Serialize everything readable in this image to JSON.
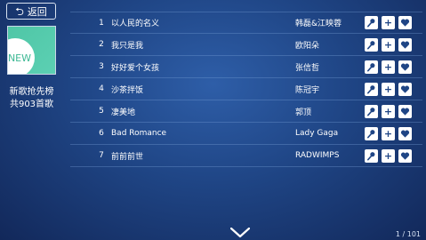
{
  "header": {
    "back_label": "返回"
  },
  "album": {
    "cover_badge": "NEW",
    "title": "新歌抢先榜",
    "count": "共903首歌"
  },
  "songs": [
    {
      "num": "1",
      "title": "以人民的名义",
      "artist": "韩磊&江映蓉"
    },
    {
      "num": "2",
      "title": "我只是我",
      "artist": "欧阳朵"
    },
    {
      "num": "3",
      "title": "好好爱个女孩",
      "artist": "张信哲"
    },
    {
      "num": "4",
      "title": "沙茶拌饭",
      "artist": "陈冠宇"
    },
    {
      "num": "5",
      "title": "凄美地",
      "artist": "郭顶"
    },
    {
      "num": "6",
      "title": "Bad Romance",
      "artist": "Lady Gaga"
    },
    {
      "num": "7",
      "title": "前前前世",
      "artist": "RADWIMPS"
    }
  ],
  "actions": {
    "icons": [
      "microphone-icon",
      "plus-icon",
      "heart-icon"
    ]
  },
  "pagination": {
    "text": "1 / 101"
  },
  "colors": {
    "background": "#1f4585",
    "cover": "#5cd0b3",
    "accent_text": "#ffffff"
  }
}
